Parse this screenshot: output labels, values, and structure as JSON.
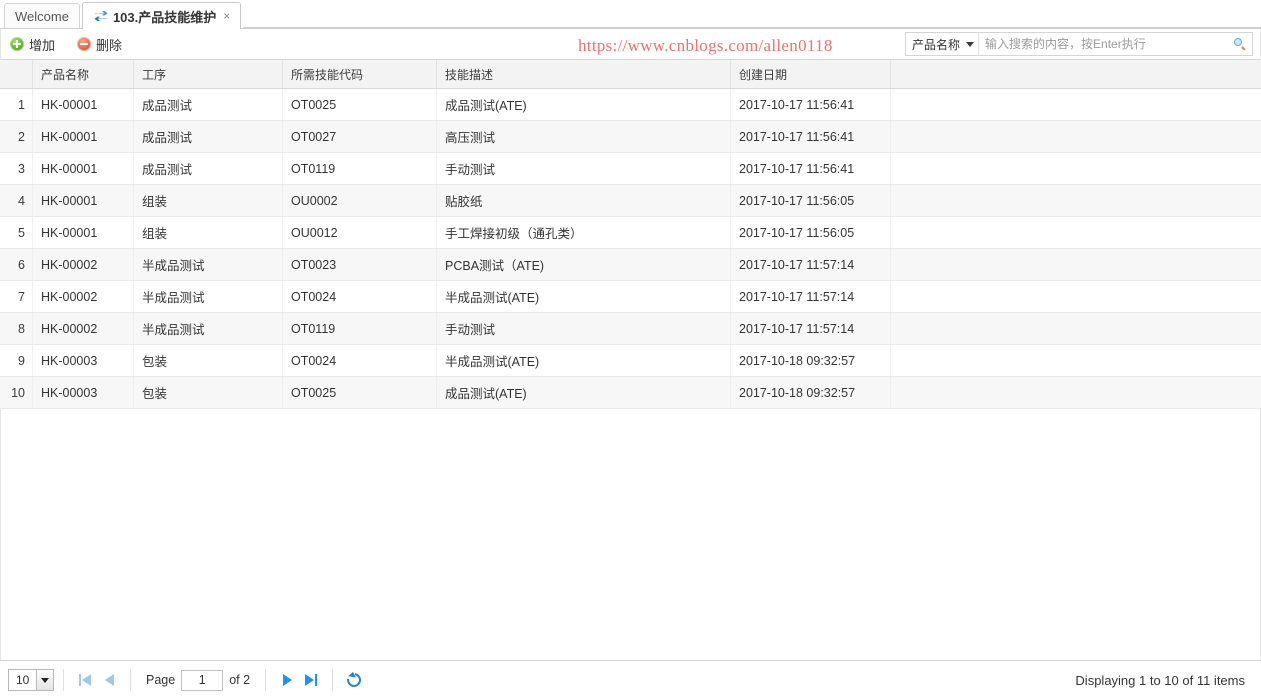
{
  "tabs": [
    {
      "label": "Welcome",
      "icon": "",
      "active": false,
      "closable": false
    },
    {
      "label": "103.产品技能维护",
      "icon": "exchange-icon",
      "active": true,
      "closable": true,
      "close_glyph": "×"
    }
  ],
  "toolbar": {
    "add_label": "增加",
    "delete_label": "删除",
    "add_icon": "add-circle-icon",
    "delete_icon": "delete-circle-icon"
  },
  "watermark": {
    "text": "https://www.cnblogs.com/allen0118",
    "color": "#f07070"
  },
  "search": {
    "field_label": "产品名称",
    "caret_icon": "chevron-down-icon",
    "placeholder": "输入搜索的内容，按Enter执行",
    "value": "",
    "search_icon": "search-icon"
  },
  "grid": {
    "columns": [
      {
        "key": "num",
        "label": ""
      },
      {
        "key": "name",
        "label": "产品名称"
      },
      {
        "key": "proc",
        "label": "工序"
      },
      {
        "key": "code",
        "label": "所需技能代码"
      },
      {
        "key": "desc",
        "label": "技能描述"
      },
      {
        "key": "date",
        "label": "创建日期"
      }
    ],
    "rows": [
      {
        "num": "1",
        "name": "HK-00001",
        "proc": "成品测试",
        "code": "OT0025",
        "desc": "成品测试(ATE)",
        "date": "2017-10-17 11:56:41"
      },
      {
        "num": "2",
        "name": "HK-00001",
        "proc": "成品测试",
        "code": "OT0027",
        "desc": "高压测试",
        "date": "2017-10-17 11:56:41"
      },
      {
        "num": "3",
        "name": "HK-00001",
        "proc": "成品测试",
        "code": "OT0119",
        "desc": "手动测试",
        "date": "2017-10-17 11:56:41"
      },
      {
        "num": "4",
        "name": "HK-00001",
        "proc": "组装",
        "code": "OU0002",
        "desc": "贴胶纸",
        "date": "2017-10-17 11:56:05"
      },
      {
        "num": "5",
        "name": "HK-00001",
        "proc": "组装",
        "code": "OU0012",
        "desc": "手工焊接初级（通孔类）",
        "date": "2017-10-17 11:56:05"
      },
      {
        "num": "6",
        "name": "HK-00002",
        "proc": "半成品测试",
        "code": "OT0023",
        "desc": "PCBA测试（ATE)",
        "date": "2017-10-17 11:57:14"
      },
      {
        "num": "7",
        "name": "HK-00002",
        "proc": "半成品测试",
        "code": "OT0024",
        "desc": "半成品测试(ATE)",
        "date": "2017-10-17 11:57:14"
      },
      {
        "num": "8",
        "name": "HK-00002",
        "proc": "半成品测试",
        "code": "OT0119",
        "desc": "手动测试",
        "date": "2017-10-17 11:57:14"
      },
      {
        "num": "9",
        "name": "HK-00003",
        "proc": "包装",
        "code": "OT0024",
        "desc": "半成品测试(ATE)",
        "date": "2017-10-18 09:32:57"
      },
      {
        "num": "10",
        "name": "HK-00003",
        "proc": "包装",
        "code": "OT0025",
        "desc": "成品测试(ATE)",
        "date": "2017-10-18 09:32:57"
      }
    ]
  },
  "pager": {
    "page_size": "10",
    "first_icon": "first-page-icon",
    "prev_icon": "prev-page-icon",
    "page_label": "Page",
    "page_value": "1",
    "of_label": "of 2",
    "next_icon": "next-page-icon",
    "last_icon": "last-page-icon",
    "refresh_icon": "refresh-icon",
    "status": "Displaying 1 to 10 of 11 items"
  }
}
